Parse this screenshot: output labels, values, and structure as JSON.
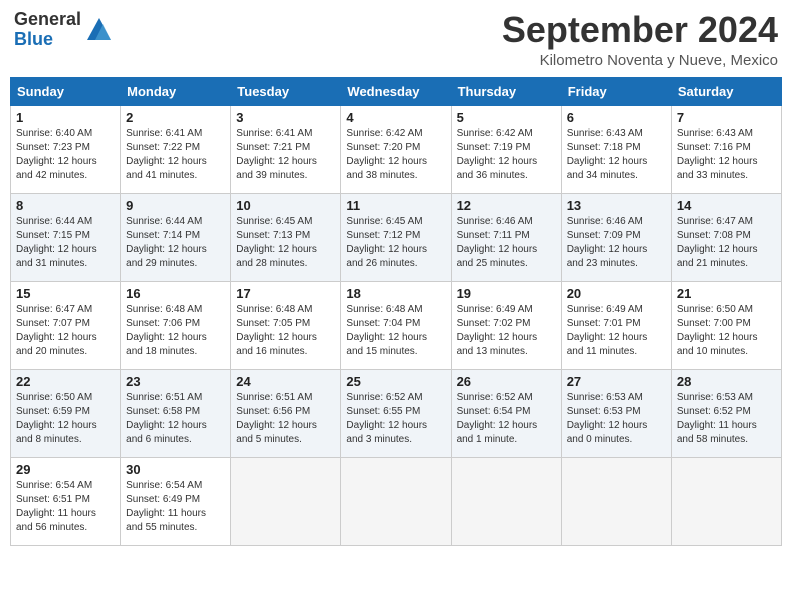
{
  "header": {
    "logo_general": "General",
    "logo_blue": "Blue",
    "month_title": "September 2024",
    "location": "Kilometro Noventa y Nueve, Mexico"
  },
  "days_of_week": [
    "Sunday",
    "Monday",
    "Tuesday",
    "Wednesday",
    "Thursday",
    "Friday",
    "Saturday"
  ],
  "weeks": [
    [
      {
        "day": "1",
        "sunrise": "6:40 AM",
        "sunset": "7:23 PM",
        "daylight": "12 hours and 42 minutes."
      },
      {
        "day": "2",
        "sunrise": "6:41 AM",
        "sunset": "7:22 PM",
        "daylight": "12 hours and 41 minutes."
      },
      {
        "day": "3",
        "sunrise": "6:41 AM",
        "sunset": "7:21 PM",
        "daylight": "12 hours and 39 minutes."
      },
      {
        "day": "4",
        "sunrise": "6:42 AM",
        "sunset": "7:20 PM",
        "daylight": "12 hours and 38 minutes."
      },
      {
        "day": "5",
        "sunrise": "6:42 AM",
        "sunset": "7:19 PM",
        "daylight": "12 hours and 36 minutes."
      },
      {
        "day": "6",
        "sunrise": "6:43 AM",
        "sunset": "7:18 PM",
        "daylight": "12 hours and 34 minutes."
      },
      {
        "day": "7",
        "sunrise": "6:43 AM",
        "sunset": "7:16 PM",
        "daylight": "12 hours and 33 minutes."
      }
    ],
    [
      {
        "day": "8",
        "sunrise": "6:44 AM",
        "sunset": "7:15 PM",
        "daylight": "12 hours and 31 minutes."
      },
      {
        "day": "9",
        "sunrise": "6:44 AM",
        "sunset": "7:14 PM",
        "daylight": "12 hours and 29 minutes."
      },
      {
        "day": "10",
        "sunrise": "6:45 AM",
        "sunset": "7:13 PM",
        "daylight": "12 hours and 28 minutes."
      },
      {
        "day": "11",
        "sunrise": "6:45 AM",
        "sunset": "7:12 PM",
        "daylight": "12 hours and 26 minutes."
      },
      {
        "day": "12",
        "sunrise": "6:46 AM",
        "sunset": "7:11 PM",
        "daylight": "12 hours and 25 minutes."
      },
      {
        "day": "13",
        "sunrise": "6:46 AM",
        "sunset": "7:09 PM",
        "daylight": "12 hours and 23 minutes."
      },
      {
        "day": "14",
        "sunrise": "6:47 AM",
        "sunset": "7:08 PM",
        "daylight": "12 hours and 21 minutes."
      }
    ],
    [
      {
        "day": "15",
        "sunrise": "6:47 AM",
        "sunset": "7:07 PM",
        "daylight": "12 hours and 20 minutes."
      },
      {
        "day": "16",
        "sunrise": "6:48 AM",
        "sunset": "7:06 PM",
        "daylight": "12 hours and 18 minutes."
      },
      {
        "day": "17",
        "sunrise": "6:48 AM",
        "sunset": "7:05 PM",
        "daylight": "12 hours and 16 minutes."
      },
      {
        "day": "18",
        "sunrise": "6:48 AM",
        "sunset": "7:04 PM",
        "daylight": "12 hours and 15 minutes."
      },
      {
        "day": "19",
        "sunrise": "6:49 AM",
        "sunset": "7:02 PM",
        "daylight": "12 hours and 13 minutes."
      },
      {
        "day": "20",
        "sunrise": "6:49 AM",
        "sunset": "7:01 PM",
        "daylight": "12 hours and 11 minutes."
      },
      {
        "day": "21",
        "sunrise": "6:50 AM",
        "sunset": "7:00 PM",
        "daylight": "12 hours and 10 minutes."
      }
    ],
    [
      {
        "day": "22",
        "sunrise": "6:50 AM",
        "sunset": "6:59 PM",
        "daylight": "12 hours and 8 minutes."
      },
      {
        "day": "23",
        "sunrise": "6:51 AM",
        "sunset": "6:58 PM",
        "daylight": "12 hours and 6 minutes."
      },
      {
        "day": "24",
        "sunrise": "6:51 AM",
        "sunset": "6:56 PM",
        "daylight": "12 hours and 5 minutes."
      },
      {
        "day": "25",
        "sunrise": "6:52 AM",
        "sunset": "6:55 PM",
        "daylight": "12 hours and 3 minutes."
      },
      {
        "day": "26",
        "sunrise": "6:52 AM",
        "sunset": "6:54 PM",
        "daylight": "12 hours and 1 minute."
      },
      {
        "day": "27",
        "sunrise": "6:53 AM",
        "sunset": "6:53 PM",
        "daylight": "12 hours and 0 minutes."
      },
      {
        "day": "28",
        "sunrise": "6:53 AM",
        "sunset": "6:52 PM",
        "daylight": "11 hours and 58 minutes."
      }
    ],
    [
      {
        "day": "29",
        "sunrise": "6:54 AM",
        "sunset": "6:51 PM",
        "daylight": "11 hours and 56 minutes."
      },
      {
        "day": "30",
        "sunrise": "6:54 AM",
        "sunset": "6:49 PM",
        "daylight": "11 hours and 55 minutes."
      },
      null,
      null,
      null,
      null,
      null
    ]
  ]
}
